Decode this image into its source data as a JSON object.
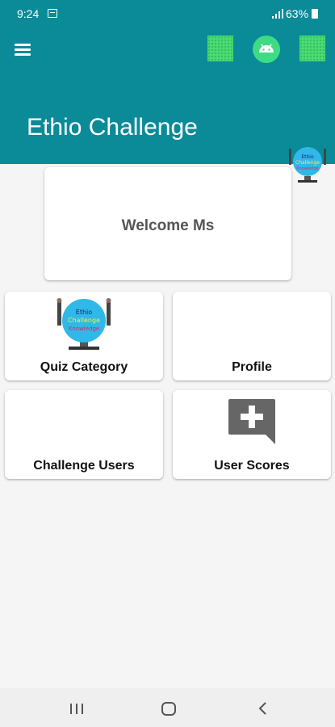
{
  "status_bar": {
    "time": "9:24",
    "battery": "63%"
  },
  "app_bar": {
    "title": "Ethio Challenge",
    "color": "#0b8a98"
  },
  "welcome": {
    "text": "Welcome Ms"
  },
  "tiles": [
    {
      "label": "Quiz Category",
      "icon": "app-logo-icon"
    },
    {
      "label": "Profile",
      "icon": ""
    },
    {
      "label": "Challenge Users",
      "icon": ""
    },
    {
      "label": "User Scores",
      "icon": "add-comment-icon"
    }
  ],
  "logo": {
    "lines": [
      "Ethio",
      "Challenge",
      "Knowledge"
    ]
  },
  "nav_bar": {
    "icons": [
      "recents-icon",
      "home-icon",
      "back-icon"
    ]
  }
}
